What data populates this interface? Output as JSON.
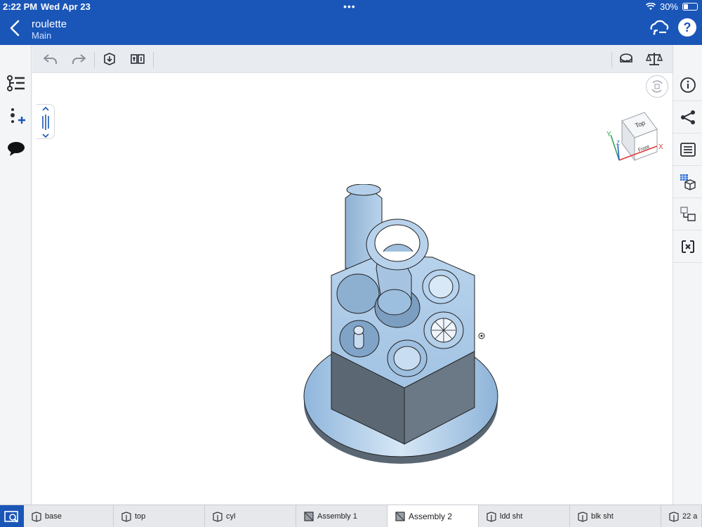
{
  "status_bar": {
    "time": "2:22 PM",
    "date": "Wed Apr 23",
    "multitask_dots": "•••",
    "battery": "30%"
  },
  "header": {
    "title": "roulette",
    "subtitle": "Main",
    "help_label": "?"
  },
  "view_cube": {
    "top_label": "Top",
    "front_label": "Front",
    "axis_x": "X",
    "axis_y": "Y",
    "axis_z": "Z"
  },
  "tabs": [
    {
      "label": "base",
      "type": "part-studio"
    },
    {
      "label": "top",
      "type": "part-studio"
    },
    {
      "label": "cyl",
      "type": "part-studio"
    },
    {
      "label": "Assembly 1",
      "type": "assembly"
    },
    {
      "label": "Assembly 2",
      "type": "assembly",
      "active": true
    },
    {
      "label": "ldd sht",
      "type": "part-studio"
    },
    {
      "label": "blk sht",
      "type": "part-studio"
    },
    {
      "label": "22 a",
      "type": "part-studio"
    }
  ],
  "colors": {
    "brand_blue": "#1a56b8",
    "model_face": "#a9c9e8",
    "model_side": "#5d6b78",
    "icon_dark": "#2b2f36"
  }
}
